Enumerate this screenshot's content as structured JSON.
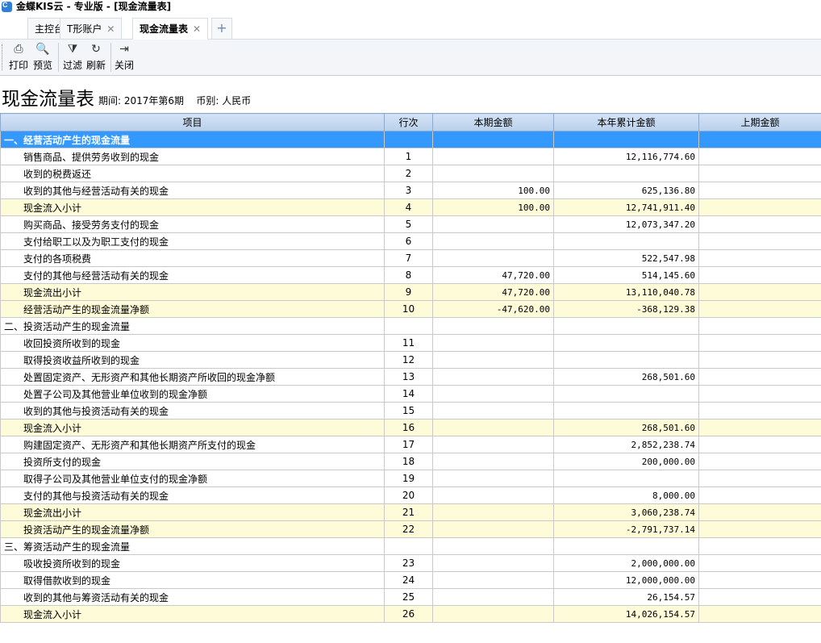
{
  "window": {
    "title": "金蝶KIS云 - 专业版 - [现金流量表]",
    "logo_text": "C"
  },
  "tabs": [
    {
      "label": "主控台",
      "closable": false,
      "active": false
    },
    {
      "label": "T形账户",
      "closable": true,
      "active": false
    },
    {
      "label": "现金流量表",
      "closable": true,
      "active": true
    }
  ],
  "tab_add_icon": "+",
  "toolbar": {
    "buttons": [
      {
        "id": "print",
        "label": "打印",
        "icon": "printer-icon",
        "glyph": "⎙"
      },
      {
        "id": "preview",
        "label": "预览",
        "icon": "preview-icon",
        "glyph": "🔍"
      },
      {
        "id": "filter",
        "label": "过滤",
        "icon": "filter-icon",
        "glyph": "⧩"
      },
      {
        "id": "refresh",
        "label": "刷新",
        "icon": "refresh-icon",
        "glyph": "↻"
      },
      {
        "id": "close",
        "label": "关闭",
        "icon": "exit-icon",
        "glyph": "⇥"
      }
    ]
  },
  "report": {
    "title": "现金流量表",
    "period_label": "期间:",
    "period_value": "2017年第6期",
    "currency_label": "币别:",
    "currency_value": "人民币"
  },
  "table": {
    "columns": [
      "项目",
      "行次",
      "本期金额",
      "本年累计金额",
      "上期金额"
    ],
    "rows": [
      {
        "item": "一、经营活动产生的现金流量",
        "line": "",
        "current": "",
        "ytd": "",
        "prior": "",
        "type": "header"
      },
      {
        "item": "销售商品、提供劳务收到的现金",
        "line": "1",
        "current": "",
        "ytd": "12,116,774.60",
        "prior": "",
        "type": "normal"
      },
      {
        "item": "收到的税费返还",
        "line": "2",
        "current": "",
        "ytd": "",
        "prior": "",
        "type": "normal"
      },
      {
        "item": "收到的其他与经营活动有关的现金",
        "line": "3",
        "current": "100.00",
        "ytd": "625,136.80",
        "prior": "",
        "type": "normal"
      },
      {
        "item": "现金流入小计",
        "line": "4",
        "current": "100.00",
        "ytd": "12,741,911.40",
        "prior": "",
        "type": "sub"
      },
      {
        "item": "购买商品、接受劳务支付的现金",
        "line": "5",
        "current": "",
        "ytd": "12,073,347.20",
        "prior": "",
        "type": "normal"
      },
      {
        "item": "支付给职工以及为职工支付的现金",
        "line": "6",
        "current": "",
        "ytd": "",
        "prior": "",
        "type": "normal"
      },
      {
        "item": "支付的各项税费",
        "line": "7",
        "current": "",
        "ytd": "522,547.98",
        "prior": "",
        "type": "normal"
      },
      {
        "item": "支付的其他与经营活动有关的现金",
        "line": "8",
        "current": "47,720.00",
        "ytd": "514,145.60",
        "prior": "",
        "type": "normal"
      },
      {
        "item": "现金流出小计",
        "line": "9",
        "current": "47,720.00",
        "ytd": "13,110,040.78",
        "prior": "",
        "type": "sub"
      },
      {
        "item": "经营活动产生的现金流量净额",
        "line": "10",
        "current": "-47,620.00",
        "ytd": "-368,129.38",
        "prior": "",
        "type": "sub"
      },
      {
        "item": "二、投资活动产生的现金流量",
        "line": "",
        "current": "",
        "ytd": "",
        "prior": "",
        "type": "section"
      },
      {
        "item": "收回投资所收到的现金",
        "line": "11",
        "current": "",
        "ytd": "",
        "prior": "",
        "type": "normal"
      },
      {
        "item": "取得投资收益所收到的现金",
        "line": "12",
        "current": "",
        "ytd": "",
        "prior": "",
        "type": "normal"
      },
      {
        "item": "处置固定资产、无形资产和其他长期资产所收回的现金净额",
        "line": "13",
        "current": "",
        "ytd": "268,501.60",
        "prior": "",
        "type": "normal"
      },
      {
        "item": "处置子公司及其他营业单位收到的现金净额",
        "line": "14",
        "current": "",
        "ytd": "",
        "prior": "",
        "type": "normal"
      },
      {
        "item": "收到的其他与投资活动有关的现金",
        "line": "15",
        "current": "",
        "ytd": "",
        "prior": "",
        "type": "normal"
      },
      {
        "item": "现金流入小计",
        "line": "16",
        "current": "",
        "ytd": "268,501.60",
        "prior": "",
        "type": "sub"
      },
      {
        "item": "购建固定资产、无形资产和其他长期资产所支付的现金",
        "line": "17",
        "current": "",
        "ytd": "2,852,238.74",
        "prior": "",
        "type": "normal"
      },
      {
        "item": "投资所支付的现金",
        "line": "18",
        "current": "",
        "ytd": "200,000.00",
        "prior": "",
        "type": "normal"
      },
      {
        "item": "取得子公司及其他营业单位支付的现金净额",
        "line": "19",
        "current": "",
        "ytd": "",
        "prior": "",
        "type": "normal"
      },
      {
        "item": "支付的其他与投资活动有关的现金",
        "line": "20",
        "current": "",
        "ytd": "8,000.00",
        "prior": "",
        "type": "normal"
      },
      {
        "item": "现金流出小计",
        "line": "21",
        "current": "",
        "ytd": "3,060,238.74",
        "prior": "",
        "type": "sub"
      },
      {
        "item": "投资活动产生的现金流量净额",
        "line": "22",
        "current": "",
        "ytd": "-2,791,737.14",
        "prior": "",
        "type": "sub"
      },
      {
        "item": "三、筹资活动产生的现金流量",
        "line": "",
        "current": "",
        "ytd": "",
        "prior": "",
        "type": "section"
      },
      {
        "item": "吸收投资所收到的现金",
        "line": "23",
        "current": "",
        "ytd": "2,000,000.00",
        "prior": "",
        "type": "normal"
      },
      {
        "item": "取得借款收到的现金",
        "line": "24",
        "current": "",
        "ytd": "12,000,000.00",
        "prior": "",
        "type": "normal"
      },
      {
        "item": "收到的其他与筹资活动有关的现金",
        "line": "25",
        "current": "",
        "ytd": "26,154.57",
        "prior": "",
        "type": "normal"
      },
      {
        "item": "现金流入小计",
        "line": "26",
        "current": "",
        "ytd": "14,026,154.57",
        "prior": "",
        "type": "sub"
      }
    ]
  },
  "colors": {
    "selected_row": "#3399ff",
    "subtotal_row": "#fdfbd8",
    "column_header": "#c7daf1"
  }
}
